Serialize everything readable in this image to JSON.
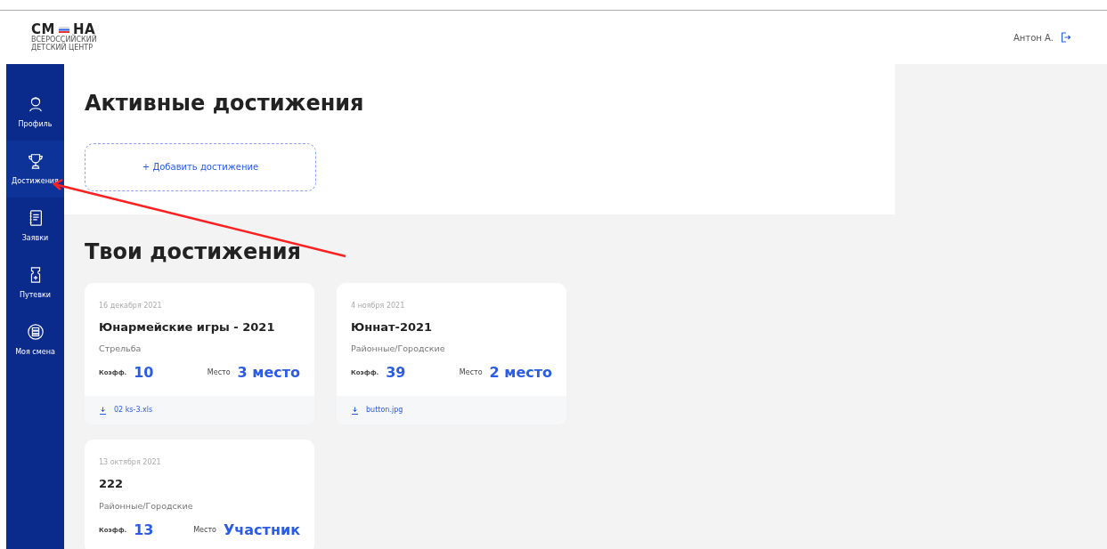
{
  "logo": {
    "word_left": "СМ",
    "word_right": "НА",
    "line_1": "ВСЕРОССИЙСКИЙ",
    "line_2": "ДЕТСКИЙ ЦЕНТР"
  },
  "user": {
    "name": "Антон А."
  },
  "sidebar": {
    "items": [
      {
        "label": "Профиль",
        "selected": false
      },
      {
        "label": "Достижения",
        "selected": true
      },
      {
        "label": "Заявки",
        "selected": false
      },
      {
        "label": "Путевки",
        "selected": false
      },
      {
        "label": "Моя смена",
        "selected": false
      }
    ]
  },
  "active_section": {
    "title": "Активные достижения",
    "add_button": "+ Добавить достижение"
  },
  "my_section": {
    "title": "Твои достижения",
    "cards": [
      {
        "date": "16 декабря 2021",
        "title": "Юнармейские игры - 2021",
        "category": "Стрельба",
        "coef_label": "Коэфф.",
        "coef": "10",
        "place_label": "Место",
        "place": "3 место",
        "file": "02 ks-3.xls"
      },
      {
        "date": "4 ноября 2021",
        "title": "Юннат-2021",
        "category": "Районные/Городские",
        "coef_label": "Коэфф.",
        "coef": "39",
        "place_label": "Место",
        "place": "2 место",
        "file": "button.jpg"
      },
      {
        "date": "13 октября 2021",
        "title": "222",
        "category": "Районные/Городские",
        "coef_label": "Коэфф.",
        "coef": "13",
        "place_label": "Место",
        "place": "Участник"
      }
    ]
  },
  "annotations": [
    {
      "kind": "arrow",
      "color": "#ff2020"
    }
  ]
}
